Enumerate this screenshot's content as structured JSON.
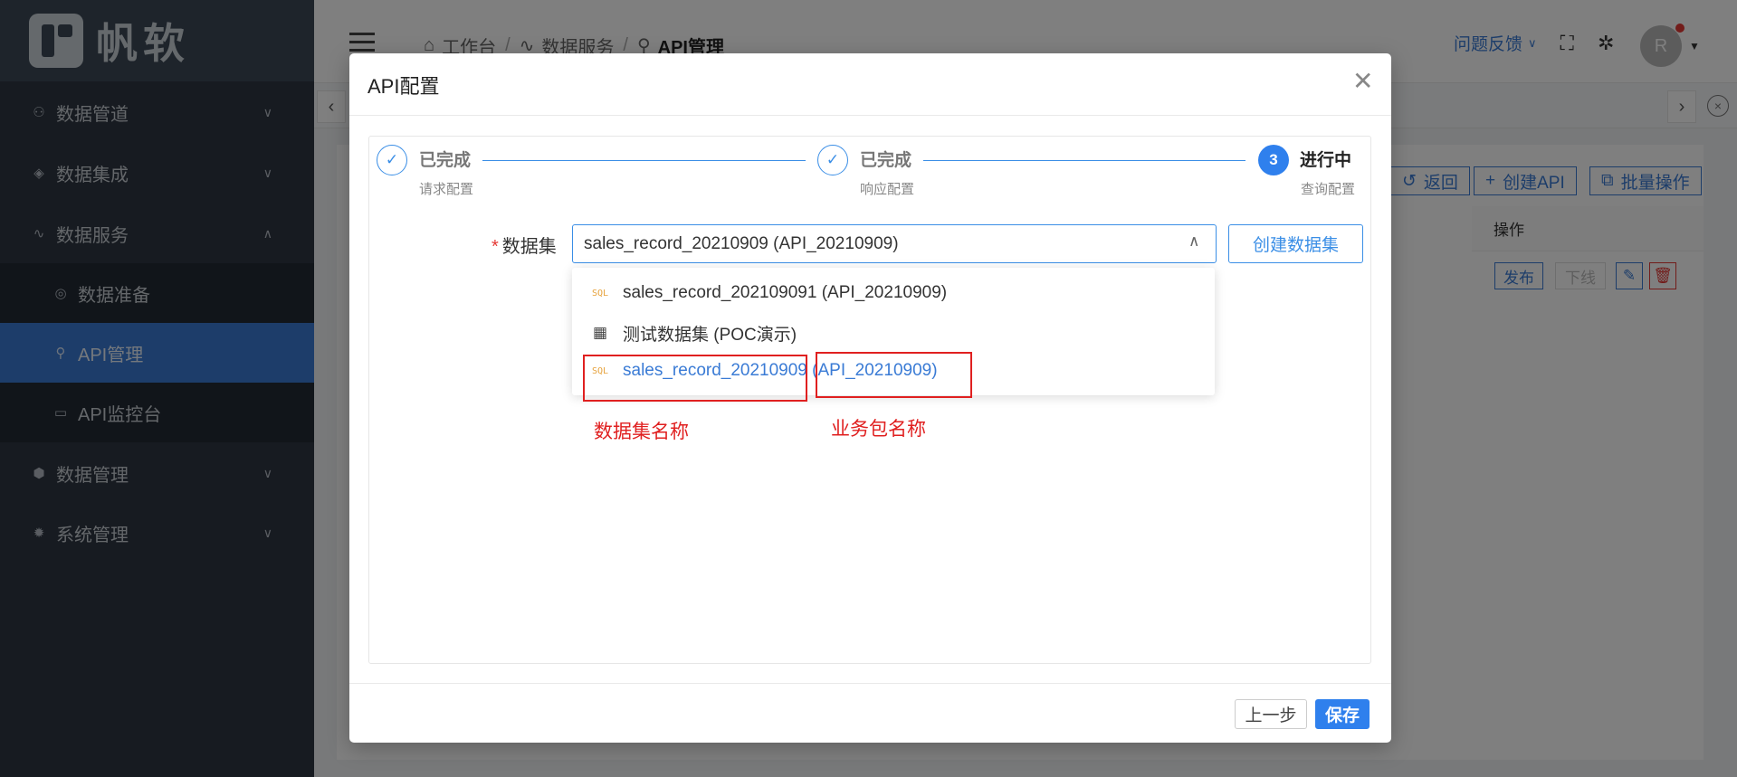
{
  "brand": {
    "name": "帆软"
  },
  "sidebar": {
    "items": [
      {
        "label": "数据管道",
        "icon": "pipeline-icon"
      },
      {
        "label": "数据集成",
        "icon": "layers-icon"
      },
      {
        "label": "数据服务",
        "icon": "pulse-icon"
      },
      {
        "label": "数据准备",
        "icon": "prepare-icon"
      },
      {
        "label": "API管理",
        "icon": "link-icon"
      },
      {
        "label": "API监控台",
        "icon": "monitor-icon"
      },
      {
        "label": "数据管理",
        "icon": "cube-icon"
      },
      {
        "label": "系统管理",
        "icon": "gear-icon"
      }
    ]
  },
  "header": {
    "breadcrumb": [
      "工作台",
      "数据服务",
      "API管理"
    ],
    "feedback": "问题反馈",
    "avatar_initial": "R"
  },
  "toolbar": {
    "back": "返回",
    "create_api": "创建API",
    "batch": "批量操作"
  },
  "table": {
    "action_header": "操作",
    "row_actions": {
      "publish": "发布",
      "offline": "下线"
    }
  },
  "modal": {
    "title": "API配置",
    "steps": [
      {
        "title": "已完成",
        "desc": "请求配置",
        "status": "done"
      },
      {
        "title": "已完成",
        "desc": "响应配置",
        "status": "done"
      },
      {
        "title": "进行中",
        "desc": "查询配置",
        "status": "active",
        "number": "3"
      }
    ],
    "field_label": "数据集",
    "selected_value": "sales_record_20210909 (API_20210909)",
    "create_dataset_button": "创建数据集",
    "options": [
      {
        "label": "sales_record_202109091 (API_20210909)",
        "icon": "sql-icon"
      },
      {
        "label": "测试数据集 (POC演示)",
        "icon": "table-icon"
      },
      {
        "label": "sales_record_20210909 (API_20210909)",
        "icon": "sql-icon",
        "selected": true
      }
    ],
    "sql_badge": "SQL",
    "annotations": {
      "dataset_name": "数据集名称",
      "package_name": "业务包名称"
    },
    "prev_button": "上一步",
    "save_button": "保存"
  },
  "colors": {
    "sidebar_bg": "#2e3742",
    "sidebar_active": "#3a7bd5",
    "primary": "#2f80ed",
    "annotation": "#e02020"
  }
}
